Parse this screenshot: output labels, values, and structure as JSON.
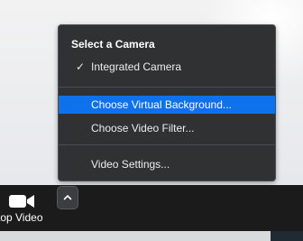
{
  "camera_menu": {
    "heading": "Select a Camera",
    "items": [
      {
        "label": "Integrated Camera",
        "checked": true
      },
      {
        "label": "Choose Virtual Background...",
        "selected": true
      },
      {
        "label": "Choose Video Filter..."
      },
      {
        "label": "Video Settings..."
      }
    ],
    "check_glyph": "✓",
    "highlight_color": "#0e72ed",
    "background_color": "#2f3133"
  },
  "toolbar": {
    "stop_video_label": "top Video",
    "video_icon": "video-camera-icon",
    "caret_icon": "chevron-up-icon"
  }
}
